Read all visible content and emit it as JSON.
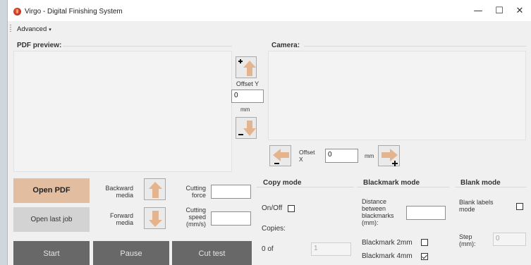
{
  "window": {
    "title": "Virgo - Digital Finishing System",
    "minimize_glyph": "—",
    "maximize_glyph": "☐",
    "close_glyph": "✕"
  },
  "menu": {
    "advanced_label": "Advanced",
    "advanced_arrow": "▾"
  },
  "pdf_preview": {
    "label": "PDF preview:"
  },
  "camera": {
    "label": "Camera:"
  },
  "offset_y": {
    "label": "Offset Y",
    "value": "0",
    "unit": "mm"
  },
  "offset_x": {
    "label": "Offset X",
    "value": "0",
    "unit": "mm"
  },
  "buttons": {
    "open_pdf": "Open PDF",
    "open_last_job": "Open last job",
    "start": "Start",
    "pause": "Pause",
    "cut_test": "Cut test"
  },
  "media": {
    "backward_label": "Backward media",
    "forward_label": "Forward media"
  },
  "cutting": {
    "force_label": "Cutting force",
    "force_value": "",
    "speed_label": "Cutting speed (mm/s)",
    "speed_value": ""
  },
  "copy_mode": {
    "title": "Copy mode",
    "onoff_label": "On/Off",
    "onoff_checked": false,
    "copies_label": "Copies:",
    "progress_label": "0 of",
    "copies_value": "1"
  },
  "blackmark_mode": {
    "title": "Blackmark mode",
    "distance_label": "Distance between blackmarks (mm):",
    "distance_value": "",
    "bm2_label": "Blackmark 2mm",
    "bm2_checked": false,
    "bm4_label": "Blackmark 4mm",
    "bm4_checked": true
  },
  "blank_mode": {
    "title": "Blank mode",
    "blank_labels_label": "Blank labels mode",
    "blank_labels_checked": false,
    "step_label": "Step (mm):",
    "step_value": "0"
  },
  "colors": {
    "arrow": "#e3b48e",
    "open_pdf_bg": "#e3bda0",
    "dark_button_bg": "#686868"
  },
  "icons": {
    "up": "arrow-up-icon",
    "down": "arrow-down-icon",
    "left": "arrow-left-icon",
    "right": "arrow-right-icon"
  }
}
